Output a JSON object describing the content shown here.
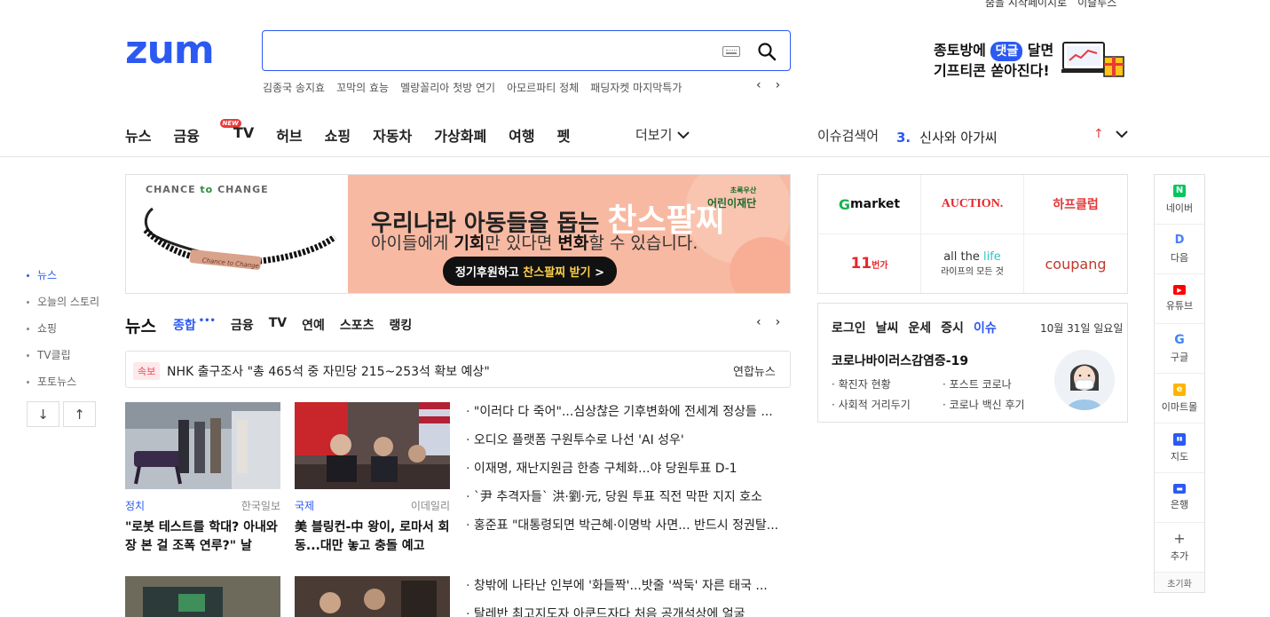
{
  "util": [
    "줌을 시작페이지로",
    "이슬루스"
  ],
  "logo": "zum",
  "search": {
    "value": "",
    "placeholder": ""
  },
  "related_words": [
    "김종국 송지효",
    "꼬막의 효능",
    "멜랑꼴리아 첫방 연기",
    "아모르파티 정체",
    "패딩자켓 마지막특가"
  ],
  "promo": {
    "line1_a": "종토방에 ",
    "line1_tag": "댓글",
    "line1_b": " 달면",
    "line2": "기프티콘 쏟아진다!"
  },
  "gnb": {
    "items": [
      "뉴스",
      "금융",
      "TV",
      "허브",
      "쇼핑",
      "자동차",
      "가상화폐",
      "여행",
      "펫"
    ],
    "new_badge": "NEW",
    "more": "더보기"
  },
  "issue": {
    "label": "이슈검색어",
    "rank": "3.",
    "keyword": "신사와 아가씨",
    "arrow": "↑"
  },
  "side_menu": [
    "뉴스",
    "오늘의 스토리",
    "쇼핑",
    "TV클립",
    "포토뉴스"
  ],
  "side_btns": [
    "↓",
    "↑"
  ],
  "ad": {
    "brand_a": "CHANCE ",
    "brand_to": "to",
    "brand_b": " CHANGE",
    "bracelet_text": "Chance to Change",
    "h1_a": "우리나라 아동들을 돕는 ",
    "h1_big": "찬스팔찌",
    "h2_a": "아이들에게 ",
    "h2_b1": "기회",
    "h2_c": "만 있다면 ",
    "h2_b2": "변화",
    "h2_d": "할 수 있습니다.",
    "cta_a": "정기후원하고 ",
    "cta_hl": "찬스팔찌 받기",
    "cta_b": " >",
    "org_small": "초록우산",
    "org": "어린이재단"
  },
  "news": {
    "title": "뉴스",
    "tabs": [
      "종합",
      "금융",
      "TV",
      "연예",
      "스포츠",
      "랭킹"
    ],
    "dots": "•••",
    "flash": {
      "badge": "속보",
      "text": "NHK 출구조사 \"총 465석 중 자민당 215~253석 확보 예상\"",
      "source": "연합뉴스"
    },
    "cards": [
      {
        "category": "정치",
        "source": "한국일보",
        "title": "\"로봇 테스트를 학대? 아내와 장 본 걸 조폭 연루?\" 날 세..."
      },
      {
        "category": "국제",
        "source": "이데일리",
        "title": "美 블링컨-中 왕이, 로마서 회동...대만 놓고 충돌 예고"
      }
    ],
    "headlines": [
      "\"이러다 다 죽어\"...심상찮은 기후변화에 전세계 정상들 ...",
      "오디오 플랫폼 구원투수로 나선 'AI 성우'",
      "이재명, 재난지원금 한층 구체화...야 당원투표 D-1",
      "`尹 추격자들` 洪·劉·元, 당원 투표 직전 막판 지지 호소",
      "홍준표 \"대통령되면 박근혜·이명박 사면... 반드시 정권탈...",
      "창밖에 나타난 인부에 '화들짝'...밧줄 '싹둑' 자른 태국 ...",
      "탈레반 최고지도자 아쿤드자다 처음 공개석상에 얼굴"
    ]
  },
  "shop": [
    {
      "a": "G",
      "b": "market"
    },
    {
      "a": "AUCTION.",
      "b": ""
    },
    {
      "a": "하프클럽",
      "b": ""
    },
    {
      "a": "11",
      "b": "번가"
    },
    {
      "a": "all the ",
      "b": "life",
      "sub": "라이프의 모든 것"
    },
    {
      "a": "coupang",
      "b": ""
    }
  ],
  "info": {
    "tabs": [
      "로그인",
      "날씨",
      "운세",
      "증시",
      "이슈"
    ],
    "date": "10월 31일 일요일",
    "title": "코로나바이러스감염증-19",
    "links": [
      "확진자 현황",
      "포스트 코로나",
      "사회적 거리두기",
      "코로나 백신 후기"
    ]
  },
  "quick": [
    {
      "label": "네이버",
      "icon": "N",
      "color": "#03c75a"
    },
    {
      "label": "다음",
      "icon": "D",
      "color": "#ffffff"
    },
    {
      "label": "유튜브",
      "icon": "▶",
      "color": "#ff0000"
    },
    {
      "label": "구글",
      "icon": "G",
      "color": "#ffffff"
    },
    {
      "label": "이마트몰",
      "icon": "e",
      "color": "#ffb400"
    },
    {
      "label": "지도",
      "icon": "▮▮",
      "color": "#2b59f2"
    },
    {
      "label": "은행",
      "icon": "▬",
      "color": "#2b59f2"
    },
    {
      "label": "추가",
      "icon": "+",
      "color": "#ffffff"
    }
  ],
  "quick_reset": "초기화",
  "colors": {
    "brand": "#2b59f2",
    "alert": "#e83a3a",
    "ad_bg": "#f8b9a2"
  }
}
